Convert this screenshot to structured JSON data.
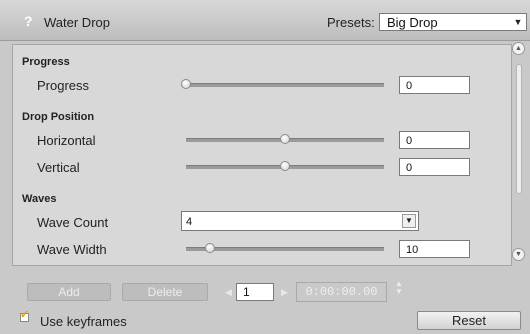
{
  "header": {
    "help_icon": "?",
    "title": "Water Drop",
    "presets_label": "Presets:",
    "presets_value": "Big Drop"
  },
  "sections": {
    "progress": {
      "title": "Progress",
      "rows": {
        "progress": {
          "label": "Progress",
          "value": "0",
          "slider_fraction": 0.0
        }
      }
    },
    "drop_position": {
      "title": "Drop Position",
      "rows": {
        "horizontal": {
          "label": "Horizontal",
          "value": "0",
          "slider_fraction": 0.5
        },
        "vertical": {
          "label": "Vertical",
          "value": "0",
          "slider_fraction": 0.5
        }
      }
    },
    "waves": {
      "title": "Waves",
      "rows": {
        "wave_count": {
          "label": "Wave Count",
          "value": "4"
        },
        "wave_width": {
          "label": "Wave Width",
          "value": "10",
          "slider_fraction": 0.12
        }
      }
    }
  },
  "controls": {
    "add_label": "Add",
    "delete_label": "Delete",
    "prev_symbol": "◀",
    "next_symbol": "▶",
    "frame_value": "1",
    "timecode": "0:00:00.00",
    "use_keyframes_label": "Use keyframes",
    "reset_label": "Reset"
  },
  "colors": {
    "background": "#c9c9c9",
    "panel": "#d8d8d8",
    "checkmark": "#e8a000"
  }
}
